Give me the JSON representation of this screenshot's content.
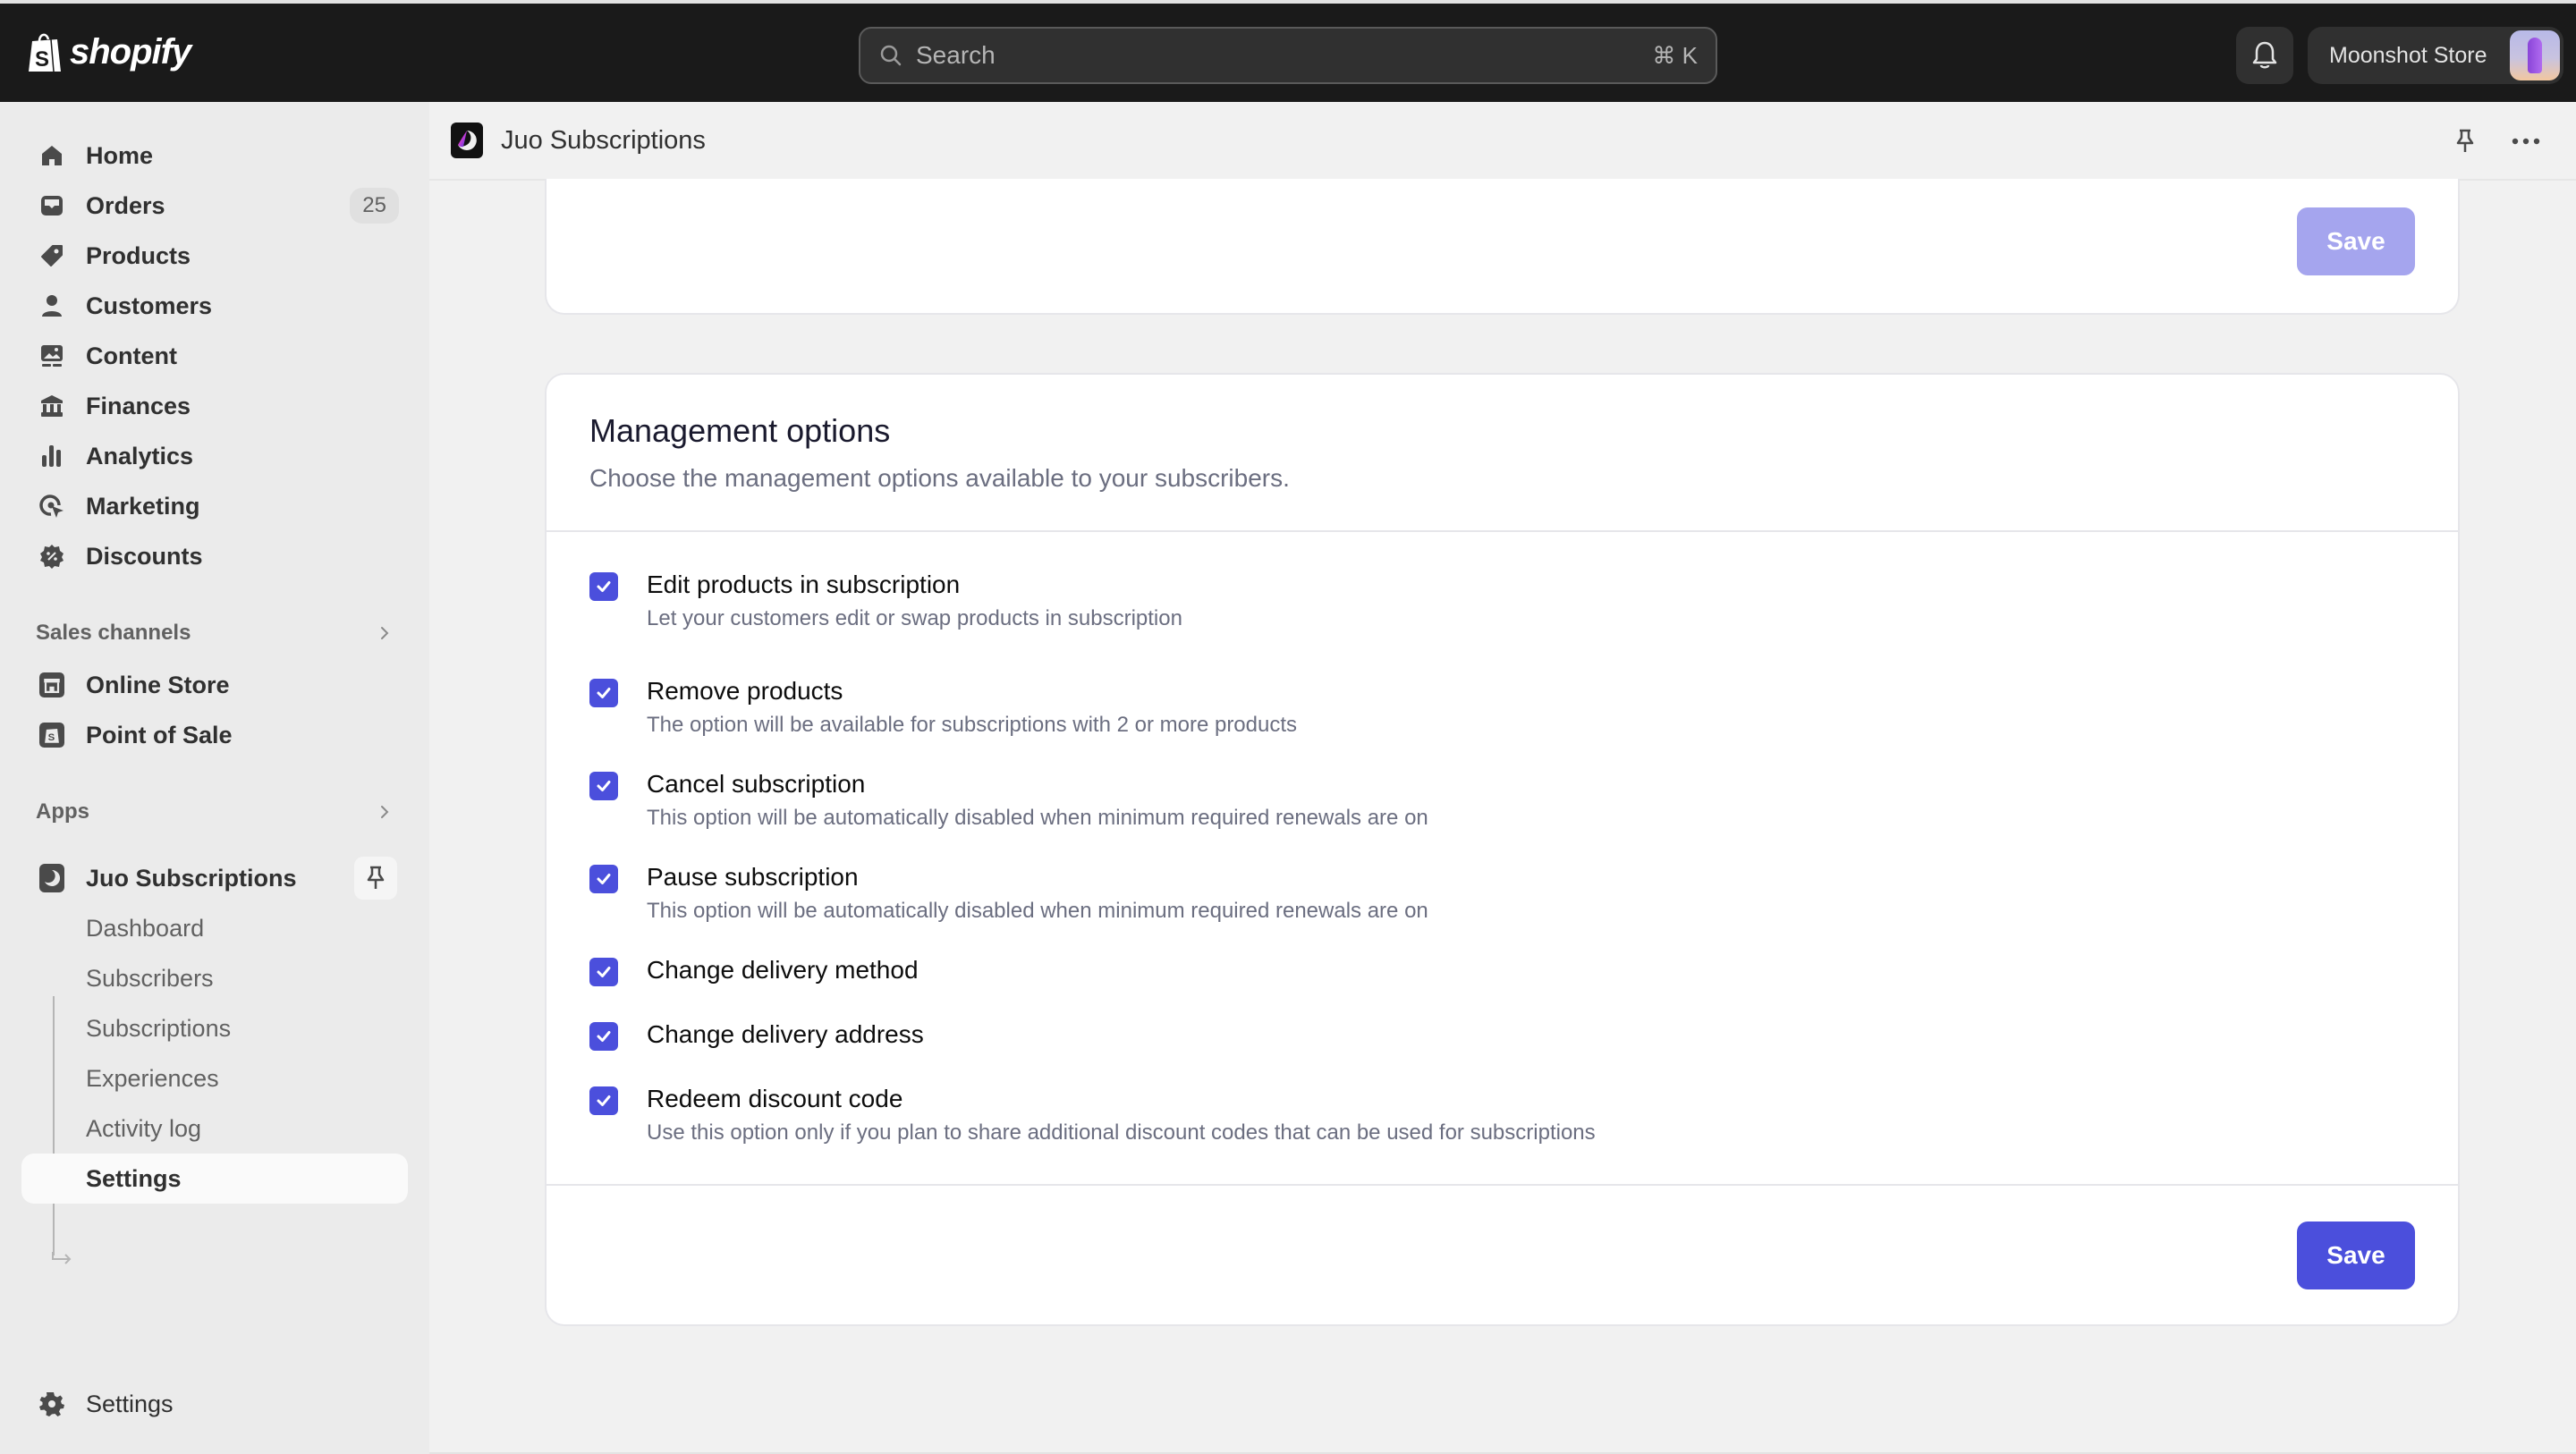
{
  "topbar": {
    "brand": "shopify",
    "search_placeholder": "Search",
    "search_shortcut": "⌘ K",
    "store_name": "Moonshot Store"
  },
  "sidebar": {
    "main_items": [
      {
        "label": "Home",
        "icon": "home-icon"
      },
      {
        "label": "Orders",
        "icon": "orders-icon",
        "badge": "25"
      },
      {
        "label": "Products",
        "icon": "tag-icon"
      },
      {
        "label": "Customers",
        "icon": "person-icon"
      },
      {
        "label": "Content",
        "icon": "content-icon"
      },
      {
        "label": "Finances",
        "icon": "bank-icon"
      },
      {
        "label": "Analytics",
        "icon": "bar-chart-icon"
      },
      {
        "label": "Marketing",
        "icon": "target-icon"
      },
      {
        "label": "Discounts",
        "icon": "discount-icon"
      }
    ],
    "sales_channels": {
      "heading": "Sales channels",
      "items": [
        {
          "label": "Online Store",
          "icon": "store-icon"
        },
        {
          "label": "Point of Sale",
          "icon": "pos-icon"
        }
      ]
    },
    "apps": {
      "heading": "Apps",
      "app_name": "Juo Subscriptions",
      "sub_items": [
        {
          "label": "Dashboard"
        },
        {
          "label": "Subscribers"
        },
        {
          "label": "Subscriptions"
        },
        {
          "label": "Experiences"
        },
        {
          "label": "Activity log"
        },
        {
          "label": "Settings",
          "active": true
        }
      ]
    },
    "settings_label": "Settings"
  },
  "app_header": {
    "title": "Juo Subscriptions"
  },
  "top_card": {
    "save_label": "Save",
    "save_disabled": true
  },
  "management": {
    "title": "Management options",
    "subtitle": "Choose the management options available to your subscribers.",
    "options": [
      {
        "title": "Edit products in subscription",
        "description": "Let your customers edit or swap products in subscription",
        "checked": true
      },
      {
        "title": "Remove products",
        "description": "The option will be available for subscriptions with 2 or more products",
        "checked": true
      },
      {
        "title": "Cancel subscription",
        "description": "This option will be automatically disabled when minimum required renewals are on",
        "checked": true
      },
      {
        "title": "Pause subscription",
        "description": "This option will be automatically disabled when minimum required renewals are on",
        "checked": true
      },
      {
        "title": "Change delivery method",
        "description": "",
        "checked": true
      },
      {
        "title": "Change delivery address",
        "description": "",
        "checked": true
      },
      {
        "title": "Redeem discount code",
        "description": "Use this option only if you plan to share additional discount codes that can be used for subscriptions",
        "checked": true
      }
    ],
    "save_label": "Save"
  },
  "colors": {
    "accent": "#4b4fdc",
    "accent_disabled": "#a5a5ee",
    "topbar_bg": "#1a1a1a",
    "sidebar_bg": "#ebebeb",
    "page_bg": "#f1f1f1"
  }
}
